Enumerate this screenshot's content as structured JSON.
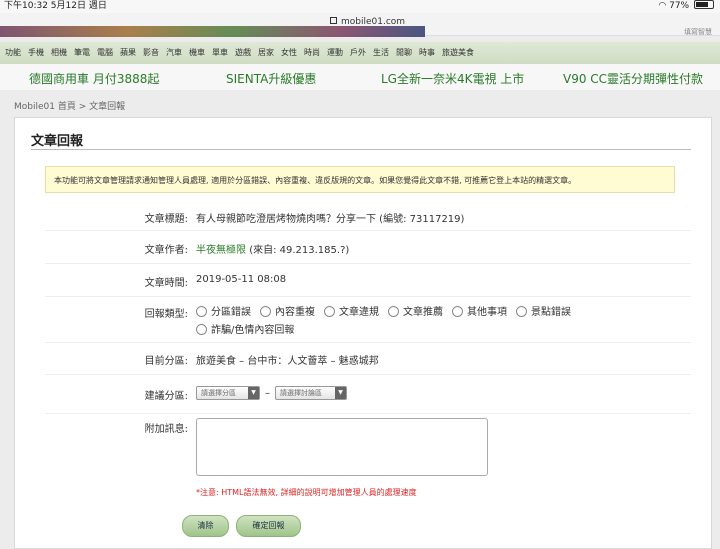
{
  "status_bar": {
    "time_date": "下午10:32  5月12日 週日",
    "battery": "77%",
    "battery_level": 0.77
  },
  "browser": {
    "url": "mobile01.com"
  },
  "banner": {
    "side_text": "填寫智慧"
  },
  "category_nav": [
    "功能",
    "手機",
    "相機",
    "筆電",
    "電腦",
    "蘋果",
    "影音",
    "汽車",
    "機車",
    "單車",
    "遊戲",
    "居家",
    "女性",
    "時尚",
    "運動",
    "戶外",
    "生活",
    "閒聊",
    "時事",
    "旅遊美食"
  ],
  "ad_links": [
    "德國商用車 月付3888起",
    "SIENTA升級優惠",
    "LG全新一奈米4K電視 上市",
    "V90 CC靈活分期彈性付款"
  ],
  "breadcrumb": "Mobile01 首頁 > 文章回報",
  "panel": {
    "title": "文章回報",
    "notice": "本功能可將文章管理請求通知管理人員處理, 適用於分區錯誤、內容重複、違反版規的文章。如果您覺得此文章不錯, 可推薦它登上本站的精選文章。",
    "fields": {
      "article_title_label": "文章標題:",
      "article_title": "有人母親節吃澄居烤物燒肉嗎？分享一下 (編號: 73117219)",
      "author_label": "文章作者:",
      "author_name": "半夜無極限",
      "author_from": "(來自: 49.213.185.?)",
      "time_label": "文章時間:",
      "time_value": "2019-05-11 08:08",
      "type_label": "回報類型:",
      "types": [
        "分區錯誤",
        "內容重複",
        "文章違規",
        "文章推薦",
        "其他事項",
        "景點錯誤",
        "詐騙/色情內容回報"
      ],
      "current_section_label": "目前分區:",
      "current_section": "旅遊美食 – 台中市：人文薈萃 – 魅惑城邦",
      "suggest_label": "建議分區:",
      "suggest_select_1": "請選擇分區",
      "suggest_dash": "–",
      "suggest_select_2": "請選擇討論區",
      "message_label": "附加訊息:",
      "message_value": ""
    },
    "warning": "*注意: HTML語法無效, 詳細的說明可增加管理人員的處理速度",
    "buttons": {
      "clear": "清除",
      "submit": "確定回報"
    }
  }
}
